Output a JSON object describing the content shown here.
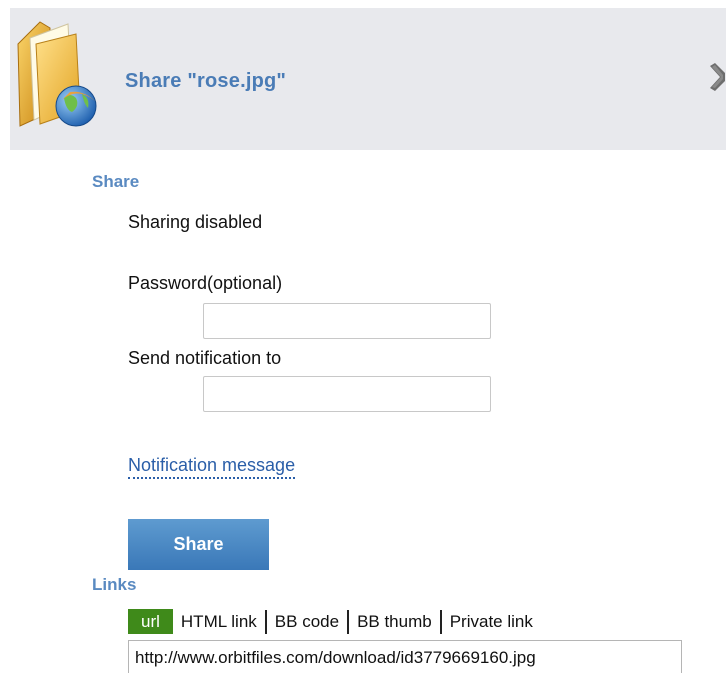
{
  "header": {
    "title": "Share \"rose.jpg\"",
    "icon": "folder-globe-icon",
    "close_icon": "close-x-icon"
  },
  "share_section": {
    "heading": "Share",
    "status": "Sharing disabled",
    "password_label": "Password(optional)",
    "password_value": "",
    "notify_label": "Send notification to",
    "notify_value": "",
    "notification_link": "Notification message",
    "share_button": "Share"
  },
  "links_section": {
    "heading": "Links",
    "tabs": [
      {
        "label": "url",
        "active": true
      },
      {
        "label": "HTML link",
        "active": false
      },
      {
        "label": "BB code",
        "active": false
      },
      {
        "label": "BB thumb",
        "active": false
      },
      {
        "label": "Private link",
        "active": false
      }
    ],
    "url_value": "http://www.orbitfiles.com/download/id3779669160.jpg"
  },
  "colors": {
    "header_bg": "#e8e9ed",
    "title": "#4a7cb6",
    "section_heading": "#5a8ac1",
    "link": "#2a5ea8",
    "button": "#3a78b8",
    "active_tab": "#3f8a1a"
  }
}
